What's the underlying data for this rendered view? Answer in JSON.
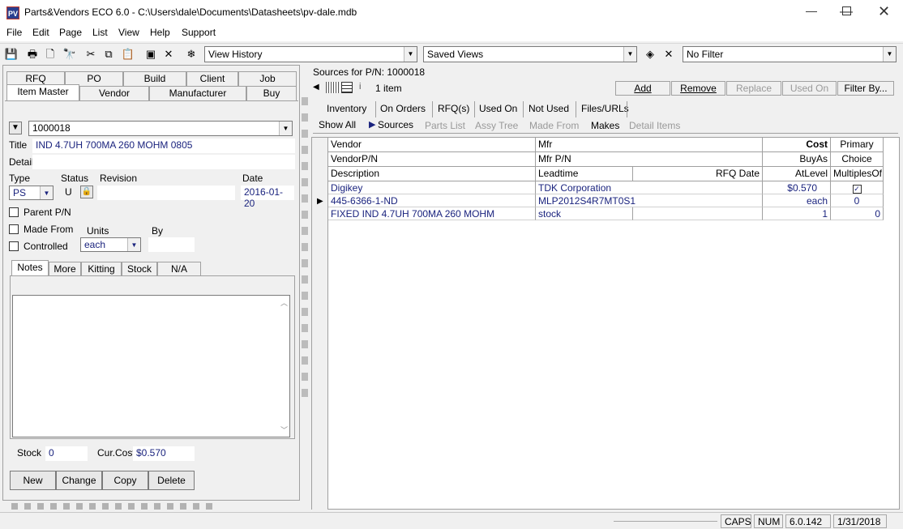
{
  "window": {
    "title": "Parts&Vendors ECO 6.0 - C:\\Users\\dale\\Documents\\Datasheets\\pv-dale.mdb",
    "app_icon_text": "PV"
  },
  "menu": [
    "File",
    "Edit",
    "Page",
    "List",
    "View",
    "Help",
    "Support"
  ],
  "toolbar": {
    "history_combo": "View History",
    "saved_views_combo": "Saved Views",
    "filter_combo": "No Filter"
  },
  "left": {
    "tabs_row1": [
      "RFQ",
      "PO",
      "Build",
      "Client",
      "Job"
    ],
    "tabs_row2": [
      "Item Master",
      "Vendor",
      "Manufacturer",
      "Buy"
    ],
    "pn_value": "1000018",
    "title_label": "Title",
    "title_value": "IND 4.7UH 700MA 260 MOHM 0805",
    "detail_label": "Detail",
    "detail_value": "",
    "type_label": "Type",
    "status_label": "Status",
    "revision_label": "Revision",
    "date_label": "Date",
    "type_value": "PS",
    "status_value": "U",
    "revision_value": "",
    "date_value": "2016-01-20",
    "parent_pn_label": "Parent P/N",
    "made_from_label": "Made From",
    "controlled_label": "Controlled",
    "units_label": "Units",
    "by_label": "By",
    "units_value": "each",
    "by_value": "",
    "subtabs": [
      "Notes",
      "More",
      "Kitting",
      "Stock",
      "N/A"
    ],
    "stock_label": "Stock",
    "stock_value": "0",
    "curcost_label": "Cur.Cost",
    "curcost_value": "$0.570",
    "buttons": [
      "New",
      "Change",
      "Copy",
      "Delete"
    ]
  },
  "right": {
    "sources_label": "Sources for P/N: 1000018",
    "item_count": "1 item",
    "actions": {
      "add": "Add",
      "remove": "Remove",
      "replace": "Replace",
      "used_on": "Used On",
      "filter_by": "Filter By..."
    },
    "tabs_row1": [
      "Inventory",
      "On Orders",
      "RFQ(s)",
      "Used On",
      "Not Used",
      "Files/URLs"
    ],
    "tabs_row2": [
      "Show All",
      "Sources",
      "Parts List",
      "Assy Tree",
      "Made From",
      "Makes",
      "Detail Items"
    ],
    "grid_headers": {
      "vendor": "Vendor",
      "mfr": "Mfr",
      "cost": "Cost",
      "primary": "Primary",
      "vendor_pn": "VendorP/N",
      "mfr_pn": "Mfr P/N",
      "buyas": "BuyAs",
      "choice": "Choice",
      "description": "Description",
      "leadtime": "Leadtime",
      "rfq_date": "RFQ Date",
      "atlevel": "AtLevel",
      "multiplesof": "MultiplesOf"
    },
    "row": {
      "vendor": "Digikey",
      "mfr": "TDK Corporation",
      "cost": "$0.570",
      "primary_checked": true,
      "vendor_pn": "445-6366-1-ND",
      "mfr_pn": "MLP2012S4R7MT0S1",
      "buyas": "each",
      "choice": "0",
      "description": "FIXED IND 4.7UH 700MA 260 MOHM",
      "leadtime": "stock",
      "rfq_date": "",
      "atlevel": "1",
      "multiplesof": "0"
    }
  },
  "status": {
    "caps": "CAPS",
    "num": "NUM",
    "version": "6.0.142",
    "date": "1/31/2018"
  }
}
